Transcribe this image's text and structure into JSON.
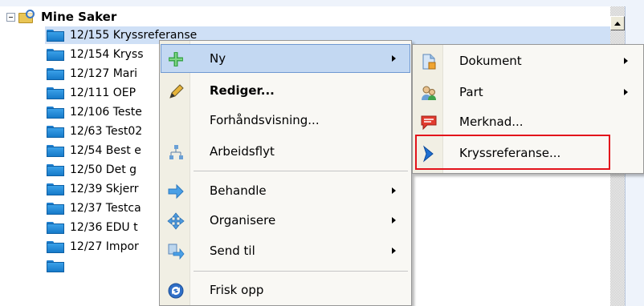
{
  "tree": {
    "root_label": "Mine Saker",
    "items": [
      {
        "label": "12/155 Kryssreferanse"
      },
      {
        "label": "12/154 Kryss"
      },
      {
        "label": "12/127 Mari"
      },
      {
        "label": "12/111 OEP"
      },
      {
        "label": "12/106 Teste"
      },
      {
        "label": "12/63 Test02"
      },
      {
        "label": "12/54 Best e"
      },
      {
        "label": "12/50 Det g"
      },
      {
        "label": "12/39 Skjerr"
      },
      {
        "label": "12/37 Testca"
      },
      {
        "label": "12/36 EDU t"
      },
      {
        "label": "12/27 Impor"
      }
    ]
  },
  "context_menu": {
    "items": [
      {
        "label": "Ny",
        "icon": "new-icon"
      },
      {
        "label": "Rediger...",
        "icon": "pencil-icon"
      },
      {
        "label": "Forhåndsvisning...",
        "icon": ""
      },
      {
        "label": "Arbeidsflyt",
        "icon": "workflow-icon"
      },
      {
        "label": "Behandle",
        "icon": "process-arrow-icon"
      },
      {
        "label": "Organisere",
        "icon": "organize-icon"
      },
      {
        "label": "Send til",
        "icon": "send-to-icon"
      },
      {
        "label": "Frisk opp",
        "icon": "refresh-icon"
      }
    ]
  },
  "submenu": {
    "items": [
      {
        "label": "Dokument",
        "icon": "document-icon"
      },
      {
        "label": "Part",
        "icon": "people-icon"
      },
      {
        "label": "Merknad...",
        "icon": "note-icon"
      },
      {
        "label": "Kryssreferanse...",
        "icon": "chevron-right-icon"
      }
    ]
  },
  "colors": {
    "selection": "#cfe0f6",
    "menu_highlight": "#c3d8f2",
    "annotation_box": "#e3131b"
  }
}
